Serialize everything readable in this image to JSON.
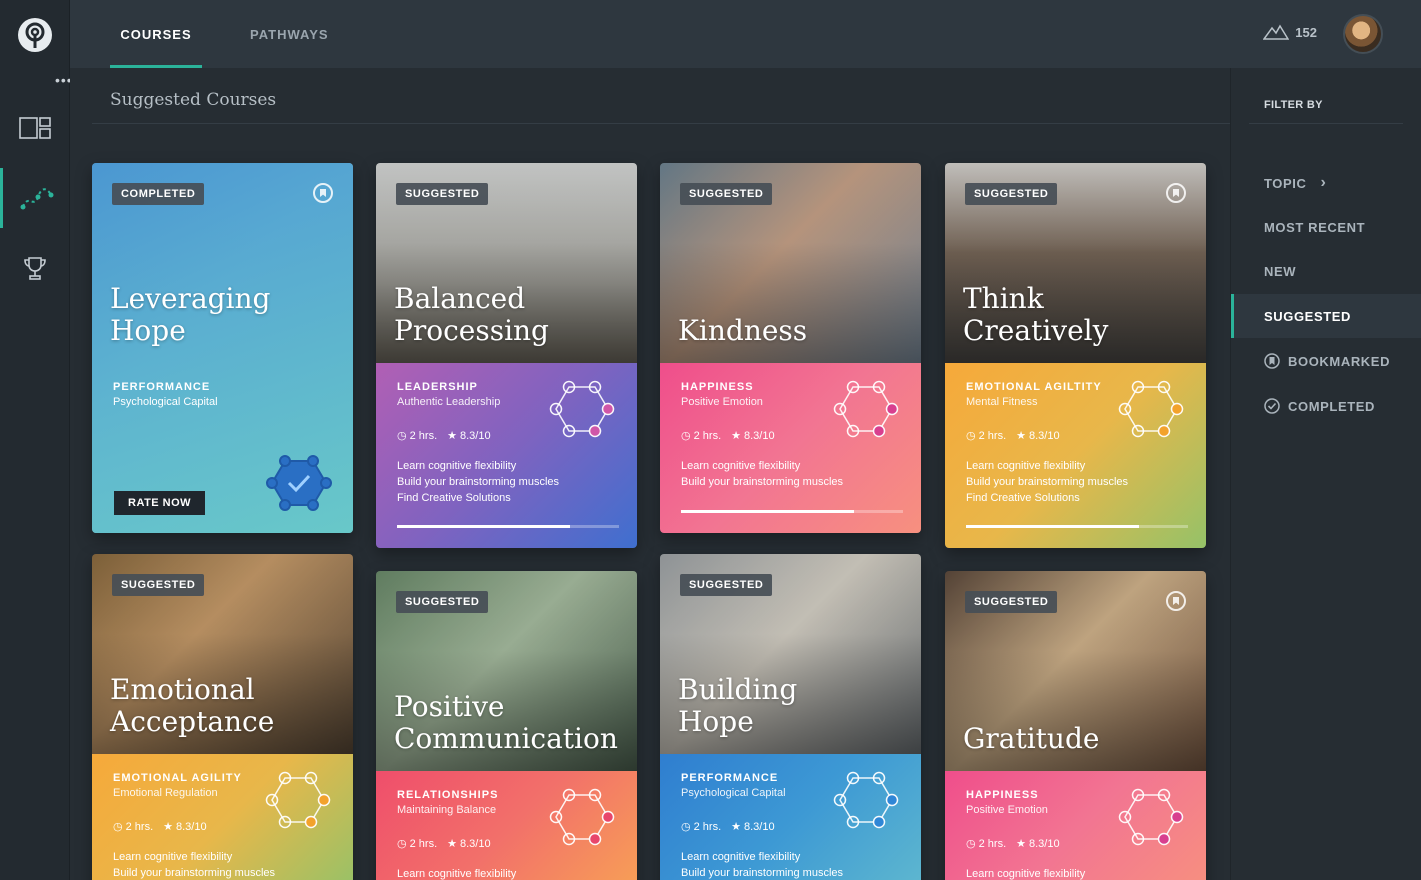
{
  "nav": {
    "tabs": [
      "COURSES",
      "PATHWAYS"
    ],
    "active_tab": "COURSES",
    "score": "152",
    "more_label": "•••"
  },
  "main": {
    "section_title": "Suggested Courses"
  },
  "filter": {
    "heading": "FILTER BY",
    "items": [
      {
        "label": "TOPIC",
        "icon": "chevron-right-icon"
      },
      {
        "label": "MOST RECENT"
      },
      {
        "label": "NEW"
      },
      {
        "label": "SUGGESTED",
        "active": true
      },
      {
        "label": "BOOKMARKED",
        "icon": "bookmark-icon"
      },
      {
        "label": "COMPLETED",
        "icon": "check-circle-icon"
      }
    ]
  },
  "cards": [
    {
      "status": "COMPLETED",
      "title_line1": "Leveraging",
      "title_line2": "Hope",
      "category": "PERFORMANCE",
      "subcategory": "Psychological Capital",
      "action": "RATE NOW",
      "bookmarked": true
    },
    {
      "status": "SUGGESTED",
      "title_line1": "Balanced",
      "title_line2": "Processing",
      "category": "LEADERSHIP",
      "subcategory": "Authentic Leadership",
      "duration": "2 hrs.",
      "rating": "8.3/10",
      "bullets": [
        "Learn cognitive flexibility",
        "Build your brainstorming muscles",
        "Find Creative Solutions"
      ],
      "progress": 0.78,
      "accent": "#d056a8"
    },
    {
      "status": "SUGGESTED",
      "title_line1": "",
      "title_line2": "Kindness",
      "category": "HAPPINESS",
      "subcategory": "Positive Emotion",
      "duration": "2 hrs.",
      "rating": "8.3/10",
      "bullets": [
        "Learn cognitive flexibility",
        "Build your brainstorming muscles"
      ],
      "progress": 0.78,
      "accent": "#d83f8f"
    },
    {
      "status": "SUGGESTED",
      "title_line1": "Think",
      "title_line2": "Creatively",
      "category": "EMOTIONAL AGILTITY",
      "subcategory": "Mental Fitness",
      "duration": "2 hrs.",
      "rating": "8.3/10",
      "bullets": [
        "Learn cognitive flexibility",
        "Build your brainstorming muscles",
        "Find Creative Solutions"
      ],
      "progress": 0.78,
      "accent": "#f3a22c",
      "bookmarked": true
    },
    {
      "status": "SUGGESTED",
      "title_line1": "Emotional",
      "title_line2": "Acceptance",
      "category": "EMOTIONAL AGILITY",
      "subcategory": "Emotional Regulation",
      "duration": "2 hrs.",
      "rating": "8.3/10",
      "bullets": [
        "Learn cognitive flexibility",
        "Build your brainstorming muscles"
      ],
      "accent": "#f3a22c"
    },
    {
      "status": "SUGGESTED",
      "title_line1": "Positive",
      "title_line2": "Communication",
      "category": "RELATIONSHIPS",
      "subcategory": "Maintaining Balance",
      "duration": "2 hrs.",
      "rating": "8.3/10",
      "bullets": [
        "Learn cognitive flexibility"
      ],
      "accent": "#e8466b"
    },
    {
      "status": "SUGGESTED",
      "title_line1": "Building",
      "title_line2": "Hope",
      "category": "PERFORMANCE",
      "subcategory": "Psychological Capital",
      "duration": "2 hrs.",
      "rating": "8.3/10",
      "bullets": [
        "Learn cognitive flexibility",
        "Build your brainstorming muscles"
      ],
      "accent": "#2f86d6"
    },
    {
      "status": "SUGGESTED",
      "title_line1": "",
      "title_line2": "Gratitude",
      "category": "HAPPINESS",
      "subcategory": "Positive Emotion",
      "duration": "2 hrs.",
      "rating": "8.3/10",
      "bullets": [
        "Learn cognitive flexibility"
      ],
      "accent": "#d83f8f",
      "bookmarked": true
    }
  ]
}
